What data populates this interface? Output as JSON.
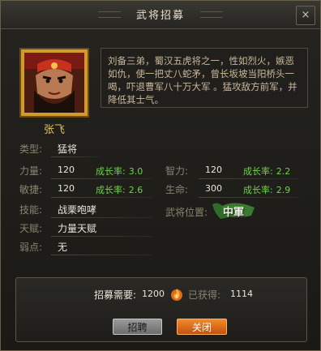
{
  "window": {
    "title": "武将招募",
    "close_label": "×"
  },
  "general": {
    "name": "张飞",
    "description": "刘备三弟，蜀汉五虎将之一，性如烈火，嫉恶如仇，使一把丈八蛇矛，曾长坂坡当阳桥头一喝，吓退曹军八十万大军 。猛攻敌方前军，并降低其士气。"
  },
  "labels": {
    "type": "类型:",
    "strength": "力量:",
    "intelligence": "智力:",
    "agility": "敏捷:",
    "life": "生命:",
    "skill": "技能:",
    "talent": "天赋:",
    "weakness": "弱点:",
    "position": "武将位置:",
    "growth": "成长率:"
  },
  "stats": {
    "type": "猛将",
    "strength": "120",
    "strength_growth": "3.0",
    "intelligence": "120",
    "intelligence_growth": "2.2",
    "agility": "120",
    "agility_growth": "2.6",
    "life": "300",
    "life_growth": "2.9",
    "skill": "战栗咆哮",
    "talent": "力量天赋",
    "weakness": "无",
    "position_badge": "中軍"
  },
  "recruit": {
    "need_label": "招募需要:",
    "need_value": "1200",
    "obtained_label": "已获得:",
    "obtained_value": "1114",
    "resource_icon": "flame-icon"
  },
  "buttons": {
    "recruit": "招聘",
    "close": "关闭"
  },
  "colors": {
    "growth": "#6fd34b",
    "name": "#e8c16a",
    "accent_orange": "#e06a1a"
  }
}
